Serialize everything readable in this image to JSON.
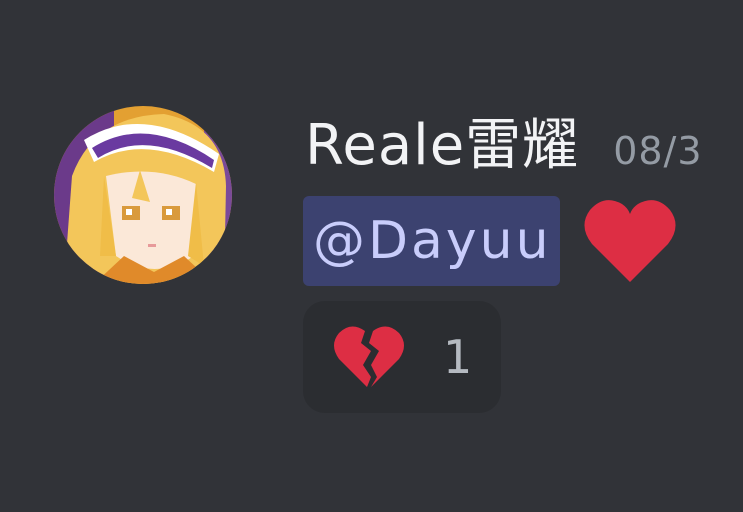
{
  "message": {
    "author": {
      "username": "Reale雷耀",
      "avatar_icon": "anime-girl-avatar"
    },
    "timestamp": "08/3",
    "content": {
      "mention": "@Dayuu",
      "emoji": "red-heart"
    },
    "reactions": [
      {
        "emoji": "broken-heart",
        "count": "1"
      }
    ]
  },
  "colors": {
    "background": "#313338",
    "username": "#f2f3f5",
    "timestamp": "#949ba4",
    "mention_bg": "#3c4270",
    "mention_text": "#c9cdfb",
    "reaction_bg": "#2b2d31",
    "heart": "#dd2e44"
  }
}
